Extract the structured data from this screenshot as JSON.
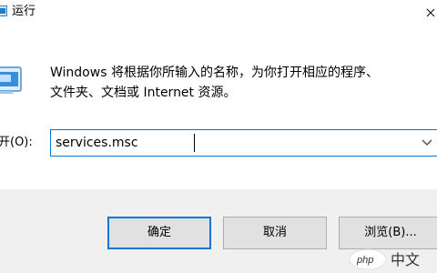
{
  "window": {
    "title": "运行",
    "close_glyph": "×"
  },
  "dialog": {
    "description_line1": "Windows 将根据你所输入的名称，为你打开相应的程序、",
    "description_line2": "文件夹、文档或 Internet 资源。",
    "open_label": "开(O):",
    "open_value": "services.msc"
  },
  "buttons": {
    "ok": "确定",
    "cancel": "取消",
    "browse": "浏览(B)..."
  },
  "watermark": {
    "text": "php 中文"
  },
  "icons": {
    "app": "run-app-icon",
    "dialog": "run-dialog-icon",
    "dropdown": "chevron-down-icon",
    "close": "close-icon"
  },
  "colors": {
    "accent": "#0078d7",
    "footer_bg": "#f0f0f0",
    "button_bg": "#e1e1e1",
    "button_border": "#adadad"
  }
}
